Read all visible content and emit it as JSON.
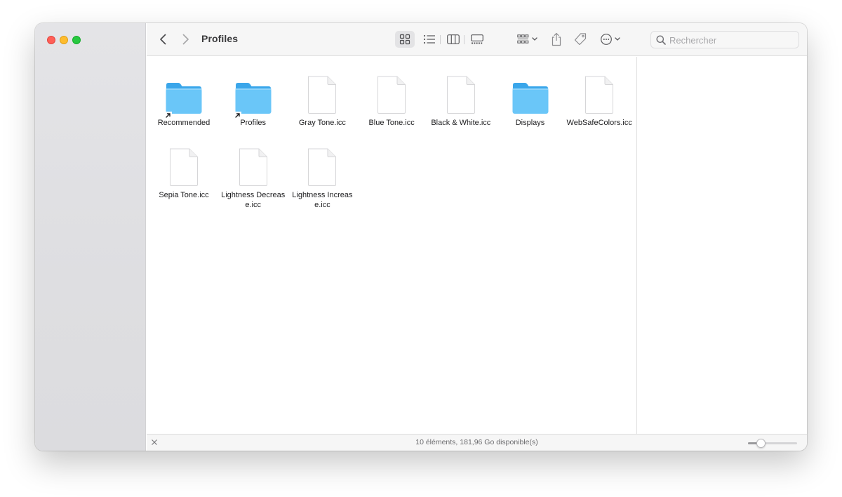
{
  "window": {
    "title": "Profiles"
  },
  "toolbar": {
    "back_icon": "chevron-left-icon",
    "forward_icon": "chevron-right-icon",
    "views": [
      "icons-view-icon",
      "list-view-icon",
      "columns-view-icon",
      "gallery-view-icon"
    ],
    "selected_view": "icons",
    "group_icon": "group-by-icon",
    "share_icon": "share-icon",
    "tag_icon": "tag-icon",
    "action_icon": "ellipsis-circle-icon"
  },
  "search": {
    "placeholder": "Rechercher",
    "value": ""
  },
  "items": [
    {
      "label": "Recommended",
      "type": "folder",
      "alias": true
    },
    {
      "label": "Profiles",
      "type": "folder",
      "alias": true
    },
    {
      "label": "Gray Tone.icc",
      "type": "file",
      "alias": false
    },
    {
      "label": "Blue Tone.icc",
      "type": "file",
      "alias": false
    },
    {
      "label": "Black & White.icc",
      "type": "file",
      "alias": false
    },
    {
      "label": "Displays",
      "type": "folder",
      "alias": false
    },
    {
      "label": "WebSafeColors.icc",
      "type": "file",
      "alias": false
    },
    {
      "label": "Sepia Tone.icc",
      "type": "file",
      "alias": false
    },
    {
      "label": "Lightness Decrease.icc",
      "type": "file",
      "alias": false
    },
    {
      "label": "Lightness Increase.icc",
      "type": "file",
      "alias": false
    }
  ],
  "status": {
    "text": "10 éléments, 181,96 Go disponible(s)",
    "icon_size_fraction": 0.25
  },
  "colors": {
    "folder_blue": "#6ac6f8",
    "folder_tab": "#3aa6ea",
    "close": "#ff5f57",
    "minimize": "#febc2e",
    "zoom": "#28c840"
  }
}
